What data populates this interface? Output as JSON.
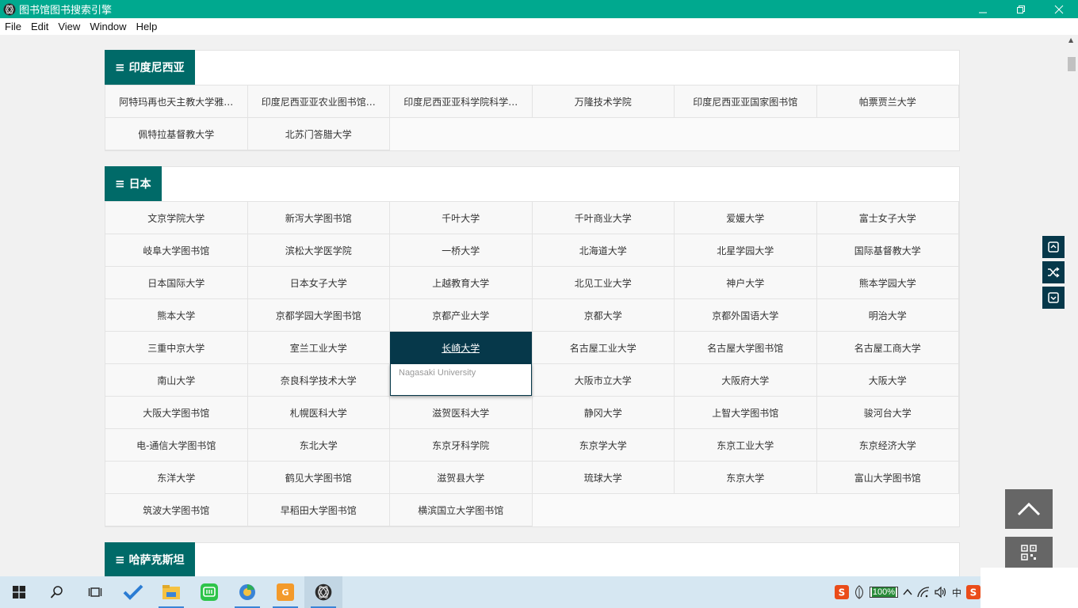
{
  "window": {
    "title": "图书馆图书搜索引擎",
    "controls": [
      "minimize",
      "maximize",
      "close"
    ]
  },
  "menu": [
    "File",
    "Edit",
    "View",
    "Window",
    "Help"
  ],
  "sections": [
    {
      "name": "印度尼西亚",
      "items": [
        "阿特玛再也天主教大学雅…",
        "印度尼西亚亚农业图书馆…",
        "印度尼西亚亚科学院科学…",
        "万隆技术学院",
        "印度尼西亚亚国家图书馆",
        "帕票贾兰大学",
        "佩特拉基督教大学",
        "北苏门答腊大学"
      ]
    },
    {
      "name": "日本",
      "items": [
        "文京学院大学",
        "新泻大学图书馆",
        "千叶大学",
        "千叶商业大学",
        "爱媛大学",
        "富士女子大学",
        "岐阜大学图书馆",
        "滨松大学医学院",
        "一桥大学",
        "北海道大学",
        "北星学园大学",
        "国际基督教大学",
        "日本国际大学",
        "日本女子大学",
        "上越教育大学",
        "北见工业大学",
        "神户大学",
        "熊本学园大学",
        "熊本大学",
        "京都学园大学图书馆",
        "京都产业大学",
        "京都大学",
        "京都外国语大学",
        "明治大学",
        "三重中京大学",
        "室兰工业大学",
        "长崎大学",
        "名古屋工业大学",
        "名古屋大学图书馆",
        "名古屋工商大学",
        "南山大学",
        "奈良科学技术大学",
        "",
        "大阪市立大学",
        "大阪府大学",
        "大阪大学",
        "大阪大学图书馆",
        "札幌医科大学",
        "滋贺医科大学",
        "静冈大学",
        "上智大学图书馆",
        "骏河台大学",
        "电-通信大学图书馆",
        "东北大学",
        "东京牙科学院",
        "东京学大学",
        "东京工业大学",
        "东京经济大学",
        "东洋大学",
        "鹤见大学图书馆",
        "滋贺县大学",
        "琉球大学",
        "东京大学",
        "富山大学图书馆",
        "筑波大学图书馆",
        "早稻田大学图书馆",
        "横滨国立大学图书馆"
      ],
      "active_item": "长崎大学",
      "tooltip": "Nagasaki University"
    },
    {
      "name": "哈萨克斯坦",
      "items": []
    }
  ],
  "taskbar": {
    "battery": "100%",
    "ime": "中"
  }
}
